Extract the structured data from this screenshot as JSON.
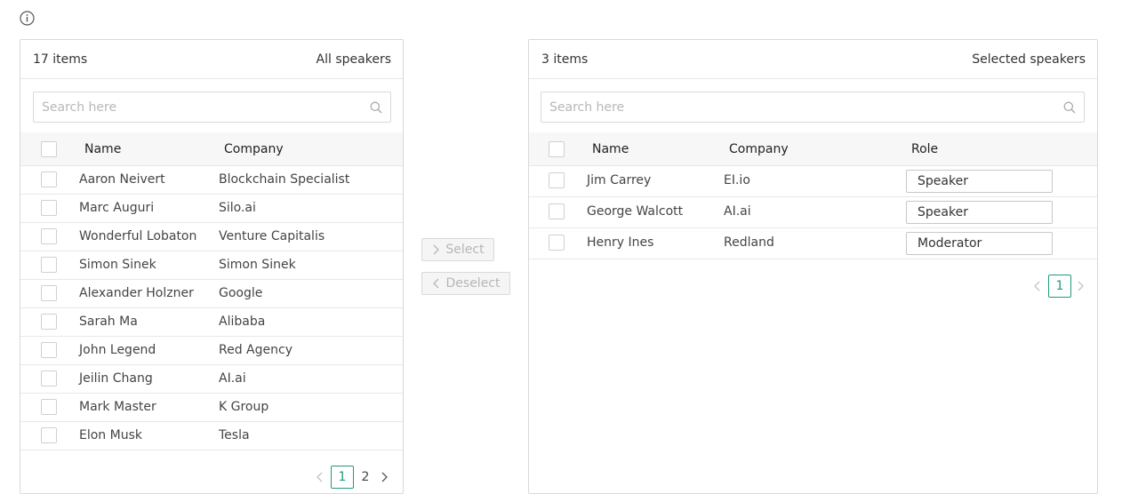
{
  "icons": {
    "info": "info-circle-icon",
    "search": "search-icon",
    "chevron_left": "chevron-left-icon",
    "chevron_right": "chevron-right-icon"
  },
  "colors": {
    "accent": "#1e9a7e",
    "border": "#d9d9d9",
    "header_bg": "#f7f7f7"
  },
  "left": {
    "count": "17 items",
    "title": "All speakers",
    "search_placeholder": "Search here",
    "columns": {
      "name": "Name",
      "company": "Company"
    },
    "rows": [
      {
        "name": "Aaron Neivert",
        "company": "Blockchain Specialist"
      },
      {
        "name": "Marc Auguri",
        "company": "Silo.ai"
      },
      {
        "name": "Wonderful Lobaton",
        "company": "Venture Capitalis"
      },
      {
        "name": "Simon Sinek",
        "company": "Simon Sinek"
      },
      {
        "name": "Alexander Holzner",
        "company": "Google"
      },
      {
        "name": "Sarah Ma",
        "company": "Alibaba"
      },
      {
        "name": "John Legend",
        "company": "Red Agency"
      },
      {
        "name": "Jeilin Chang",
        "company": "AI.ai"
      },
      {
        "name": "Mark Master",
        "company": "K Group"
      },
      {
        "name": "Elon Musk",
        "company": "Tesla"
      }
    ],
    "pagination": {
      "pages": [
        "1",
        "2"
      ],
      "current": "1"
    }
  },
  "transfer": {
    "select_label": "Select",
    "deselect_label": "Deselect"
  },
  "right": {
    "count": "3 items",
    "title": "Selected speakers",
    "search_placeholder": "Search here",
    "columns": {
      "name": "Name",
      "company": "Company",
      "role": "Role"
    },
    "rows": [
      {
        "name": "Jim Carrey",
        "company": "EI.io",
        "role": "Speaker"
      },
      {
        "name": "George Walcott",
        "company": "AI.ai",
        "role": "Speaker"
      },
      {
        "name": "Henry Ines",
        "company": "Redland",
        "role": "Moderator"
      }
    ],
    "pagination": {
      "pages": [
        "1"
      ],
      "current": "1"
    }
  }
}
